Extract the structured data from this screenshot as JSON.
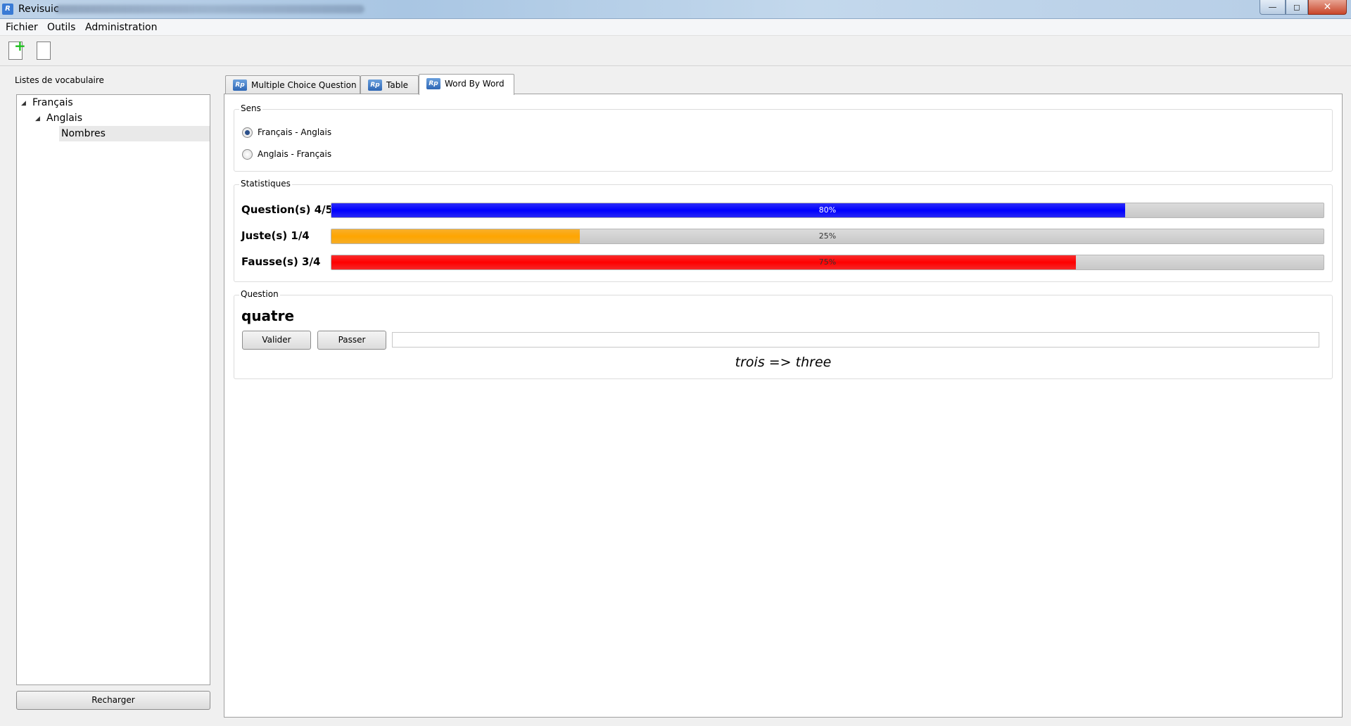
{
  "window": {
    "title": "Revisuic",
    "icon": "app-icon",
    "buttons": {
      "minimize": "—",
      "maximize": "◻",
      "close": "✕"
    }
  },
  "menu": [
    "Fichier",
    "Outils",
    "Administration"
  ],
  "toolbar": {
    "new_list_icon": "new-document-plus-icon",
    "blank_icon": "blank-document-icon"
  },
  "sidebar": {
    "label": "Listes de vocabulaire",
    "tree": [
      {
        "label": "Français",
        "expanded": true
      },
      {
        "label": "Anglais",
        "expanded": true
      },
      {
        "label": "Nombres",
        "selected": true
      }
    ],
    "reload_label": "Recharger"
  },
  "tabs": [
    {
      "label": "Multiple Choice Question",
      "active": false
    },
    {
      "label": "Table",
      "active": false
    },
    {
      "label": "Word By Word",
      "active": true
    }
  ],
  "sens": {
    "title": "Sens",
    "options": [
      {
        "label": "Français - Anglais",
        "checked": true
      },
      {
        "label": "Anglais - Français",
        "checked": false
      }
    ]
  },
  "statistiques": {
    "title": "Statistiques",
    "rows": [
      {
        "label": "Question(s) 4/5",
        "percent": 80,
        "text": "80%",
        "color": "#0000ff"
      },
      {
        "label": "Juste(s) 1/4",
        "percent": 25,
        "text": "25%",
        "color": "#ffa500"
      },
      {
        "label": "Fausse(s) 3/4",
        "percent": 75,
        "text": "75%",
        "color": "#ff0000"
      }
    ]
  },
  "question": {
    "title": "Question",
    "word": "quatre",
    "validate_label": "Valider",
    "skip_label": "Passer",
    "answer_value": "",
    "feedback": "trois => three"
  }
}
